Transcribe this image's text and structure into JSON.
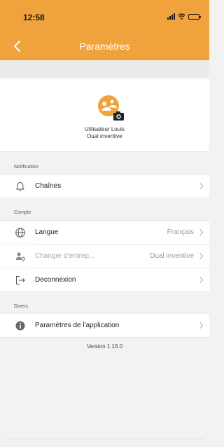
{
  "status_bar": {
    "time": "12:58",
    "icons": [
      "signal-icon",
      "wifi-icon",
      "battery-icon"
    ]
  },
  "nav": {
    "title": "Paramètres",
    "back_icon": "chevron-left-icon"
  },
  "profile": {
    "avatar_icon": "user-avatar-icon",
    "camera_icon": "camera-icon",
    "user_name": "Utilisateur Louis",
    "company": "Dual inventive"
  },
  "sections": {
    "notification": {
      "header": "Notification",
      "items": [
        {
          "label": "Chaînes",
          "icon": "bell-icon"
        }
      ]
    },
    "compte": {
      "header": "Compte",
      "items": [
        {
          "label": "Langue",
          "value": "Français",
          "icon": "globe-icon"
        },
        {
          "label": "Changer d'entrep...",
          "value": "Dual inventive",
          "icon": "user-settings-icon"
        },
        {
          "label": "Deconnexion",
          "icon": "logout-icon"
        }
      ]
    },
    "divers": {
      "header": "Divers",
      "items": [
        {
          "label": "Paramètres de l'application",
          "icon": "info-icon"
        }
      ]
    }
  },
  "version": "Version 1.16.0",
  "colors": {
    "accent": "#f0a23c",
    "background": "#f2f2f2",
    "row_bg": "#ffffff"
  }
}
